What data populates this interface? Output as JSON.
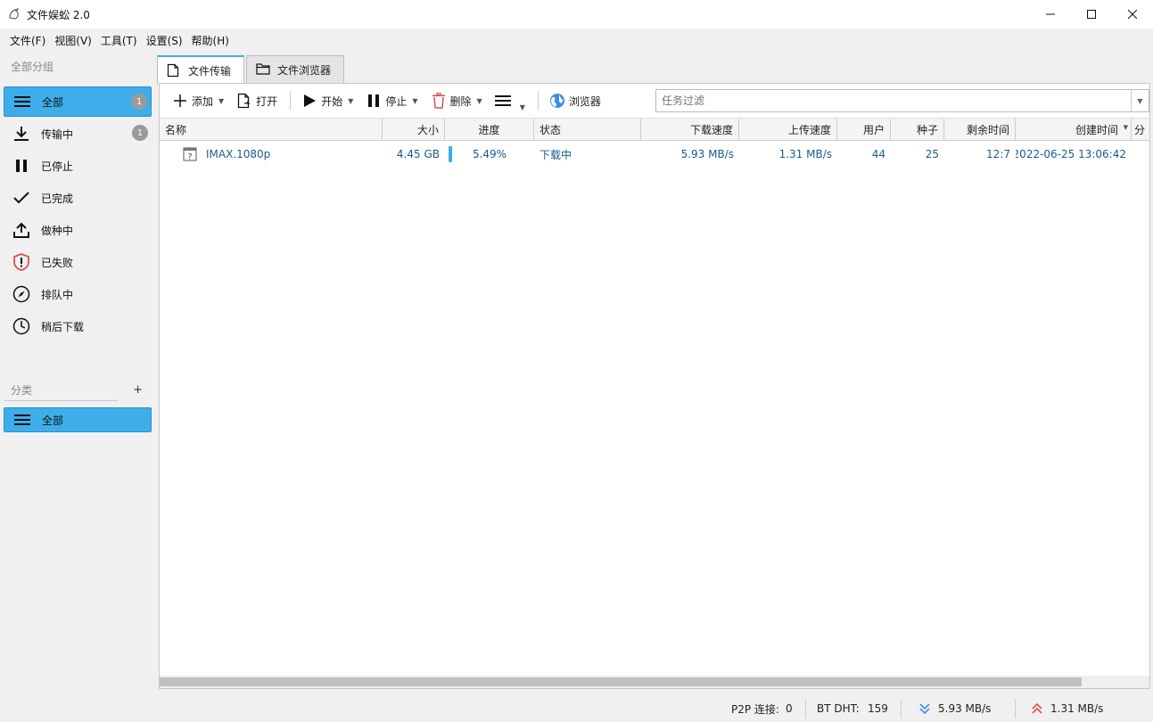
{
  "window": {
    "title": "文件娱蚣 2.0"
  },
  "menu": [
    "文件(F)",
    "视图(V)",
    "工具(T)",
    "设置(S)",
    "帮助(H)"
  ],
  "sidebar": {
    "group_header": "全部分组",
    "items": [
      {
        "label": "全部",
        "icon": "list-icon",
        "badge": "1"
      },
      {
        "label": "传输中",
        "icon": "download-icon",
        "badge": "1"
      },
      {
        "label": "已停止",
        "icon": "pause-icon"
      },
      {
        "label": "已完成",
        "icon": "check-icon"
      },
      {
        "label": "做种中",
        "icon": "upload-icon"
      },
      {
        "label": "已失败",
        "icon": "shield-alert-icon"
      },
      {
        "label": "排队中",
        "icon": "compass-icon"
      },
      {
        "label": "稍后下载",
        "icon": "clock-icon"
      }
    ],
    "category_header": "分类",
    "category_add": "+",
    "category_items": [
      {
        "label": "全部",
        "icon": "list-icon"
      }
    ]
  },
  "tabs": [
    {
      "label": "文件传输",
      "icon": "document-icon",
      "active": true
    },
    {
      "label": "文件浏览器",
      "icon": "folder-icon",
      "active": false
    }
  ],
  "toolbar": {
    "add": "添加",
    "open": "打开",
    "start": "开始",
    "stop": "停止",
    "delete": "删除",
    "browser": "浏览器",
    "filter_placeholder": "任务过滤"
  },
  "table": {
    "columns": [
      "名称",
      "大小",
      "进度",
      "状态",
      "下载速度",
      "上传速度",
      "用户",
      "种子",
      "剩余时间",
      "创建时间",
      "分"
    ],
    "rows": [
      {
        "name": "IMAX.1080p",
        "size": "4.45 GB",
        "progress": "5.49%",
        "progress_fraction": 0.0549,
        "status": "下载中",
        "down_speed": "5.93 MB/s",
        "up_speed": "1.31 MB/s",
        "users": "44",
        "seeds": "25",
        "remaining": "12:7",
        "created": "2022-06-25 13:06:42"
      }
    ]
  },
  "status": {
    "p2p_label": "P2P 连接:",
    "p2p_value": "0",
    "dht_label": "BT DHT:",
    "dht_value": "159",
    "down": "5.93 MB/s",
    "up": "1.31 MB/s"
  },
  "colors": {
    "accent": "#3daee9",
    "delete_red": "#d9534f",
    "down_blue": "#3d8ee9",
    "up_red": "#e0524f"
  }
}
